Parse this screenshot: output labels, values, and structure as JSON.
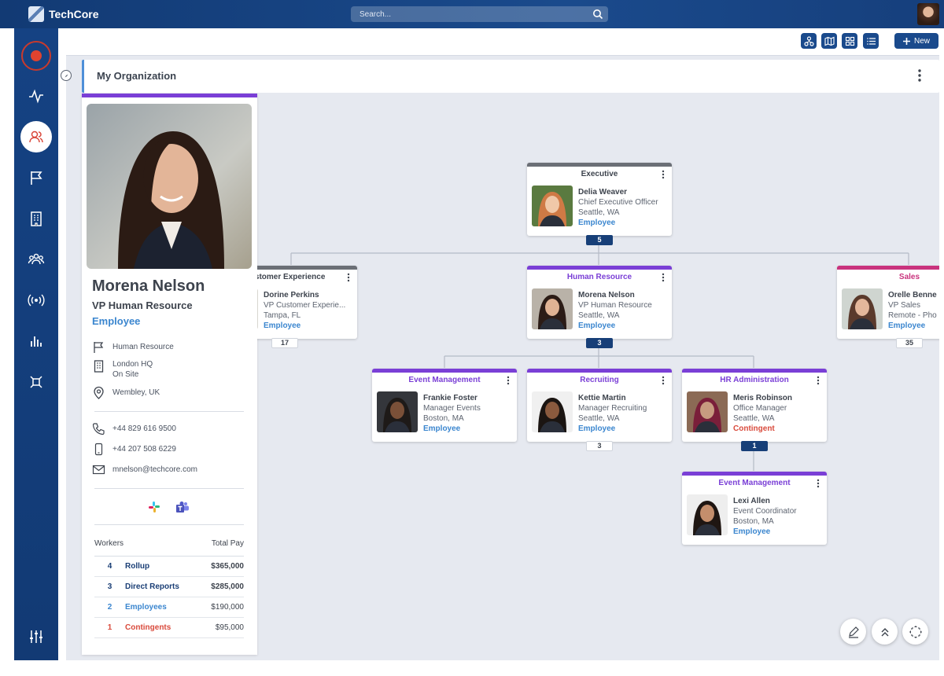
{
  "app": {
    "name": "TechCore"
  },
  "search": {
    "placeholder": "Search..."
  },
  "toolbar": {
    "new_label": "New",
    "views": [
      "hierarchy-view-icon",
      "map-view-icon",
      "grid-view-icon",
      "list-view-icon"
    ]
  },
  "sidebar": {
    "items": [
      "pulse-icon",
      "people-icon",
      "flag-icon",
      "building-icon",
      "team-icon",
      "broadcast-icon",
      "bar-chart-icon",
      "network-icon",
      "sliders-icon"
    ],
    "active": "people-icon"
  },
  "page": {
    "title": "My Organization"
  },
  "profile": {
    "name": "Morena Nelson",
    "title": "VP Human Resource",
    "type": "Employee",
    "department": "Human Resource",
    "office": "London HQ",
    "office_mode": "On Site",
    "location": "Wembley, UK",
    "phone": "+44 829 616 9500",
    "mobile": "+44 207 508 6229",
    "email": "mnelson@techcore.com",
    "stats_header": {
      "workers": "Workers",
      "total_pay": "Total Pay"
    },
    "stats": [
      {
        "count": "4",
        "label": "Rollup",
        "pay": "$365,000",
        "color": "#1a3e75"
      },
      {
        "count": "3",
        "label": "Direct Reports",
        "pay": "$285,000",
        "color": "#1a3e75"
      },
      {
        "count": "2",
        "label": "Employees",
        "pay": "$190,000",
        "color": "#3b86cf"
      },
      {
        "count": "1",
        "label": "Contingents",
        "pay": "$95,000",
        "color": "#d94a3c"
      }
    ]
  },
  "org": {
    "cards": [
      {
        "dept": "Executive",
        "name": "Delia Weaver",
        "title": "Chief Executive Officer",
        "location": "Seattle, WA",
        "type": "Employee",
        "count": "5"
      },
      {
        "dept": "Customer Experience",
        "name": "Dorine Perkins",
        "title": "VP Customer Experie...",
        "location": "Tampa, FL",
        "type": "Employee",
        "count": "17"
      },
      {
        "dept": "Human Resource",
        "name": "Morena Nelson",
        "title": "VP Human Resource",
        "location": "Seattle, WA",
        "type": "Employee",
        "count": "3"
      },
      {
        "dept": "Sales",
        "name": "Orelle Benne",
        "title": "VP Sales",
        "location": "Remote - Pho",
        "type": "Employee",
        "count": "35"
      },
      {
        "dept": "Event Management",
        "name": "Frankie Foster",
        "title": "Manager Events",
        "location": "Boston, MA",
        "type": "Employee"
      },
      {
        "dept": "Recruiting",
        "name": "Kettie Martin",
        "title": "Manager Recruiting",
        "location": "Seattle, WA",
        "type": "Employee",
        "count": "3"
      },
      {
        "dept": "HR Administration",
        "name": "Meris Robinson",
        "title": "Office Manager",
        "location": "Seattle, WA",
        "type": "Contingent",
        "count": "1"
      },
      {
        "dept": "Event Management",
        "name": "Lexi Allen",
        "title": "Event Coordinator",
        "location": "Boston, MA",
        "type": "Employee"
      }
    ]
  },
  "colors": {
    "brand": "#1a4a8c",
    "employee": "#3b86cf",
    "contingent": "#d94a3c",
    "dept_purple": "#7a3fd6",
    "dept_executive": "#6b6f76",
    "dept_sales": "#c9337d"
  }
}
